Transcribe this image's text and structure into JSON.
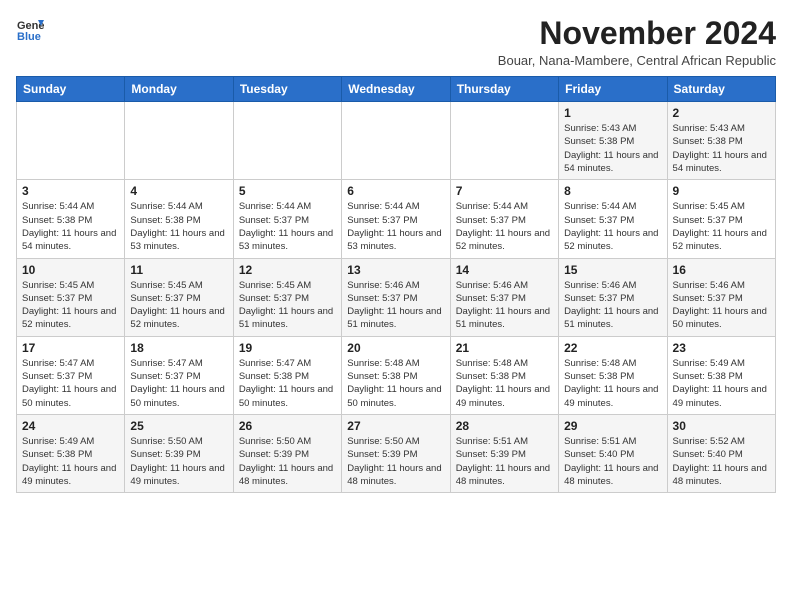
{
  "header": {
    "logo_general": "General",
    "logo_blue": "Blue",
    "title": "November 2024",
    "subtitle": "Bouar, Nana-Mambere, Central African Republic"
  },
  "weekdays": [
    "Sunday",
    "Monday",
    "Tuesday",
    "Wednesday",
    "Thursday",
    "Friday",
    "Saturday"
  ],
  "weeks": [
    [
      {
        "day": "",
        "info": ""
      },
      {
        "day": "",
        "info": ""
      },
      {
        "day": "",
        "info": ""
      },
      {
        "day": "",
        "info": ""
      },
      {
        "day": "",
        "info": ""
      },
      {
        "day": "1",
        "info": "Sunrise: 5:43 AM\nSunset: 5:38 PM\nDaylight: 11 hours and 54 minutes."
      },
      {
        "day": "2",
        "info": "Sunrise: 5:43 AM\nSunset: 5:38 PM\nDaylight: 11 hours and 54 minutes."
      }
    ],
    [
      {
        "day": "3",
        "info": "Sunrise: 5:44 AM\nSunset: 5:38 PM\nDaylight: 11 hours and 54 minutes."
      },
      {
        "day": "4",
        "info": "Sunrise: 5:44 AM\nSunset: 5:38 PM\nDaylight: 11 hours and 53 minutes."
      },
      {
        "day": "5",
        "info": "Sunrise: 5:44 AM\nSunset: 5:37 PM\nDaylight: 11 hours and 53 minutes."
      },
      {
        "day": "6",
        "info": "Sunrise: 5:44 AM\nSunset: 5:37 PM\nDaylight: 11 hours and 53 minutes."
      },
      {
        "day": "7",
        "info": "Sunrise: 5:44 AM\nSunset: 5:37 PM\nDaylight: 11 hours and 52 minutes."
      },
      {
        "day": "8",
        "info": "Sunrise: 5:44 AM\nSunset: 5:37 PM\nDaylight: 11 hours and 52 minutes."
      },
      {
        "day": "9",
        "info": "Sunrise: 5:45 AM\nSunset: 5:37 PM\nDaylight: 11 hours and 52 minutes."
      }
    ],
    [
      {
        "day": "10",
        "info": "Sunrise: 5:45 AM\nSunset: 5:37 PM\nDaylight: 11 hours and 52 minutes."
      },
      {
        "day": "11",
        "info": "Sunrise: 5:45 AM\nSunset: 5:37 PM\nDaylight: 11 hours and 52 minutes."
      },
      {
        "day": "12",
        "info": "Sunrise: 5:45 AM\nSunset: 5:37 PM\nDaylight: 11 hours and 51 minutes."
      },
      {
        "day": "13",
        "info": "Sunrise: 5:46 AM\nSunset: 5:37 PM\nDaylight: 11 hours and 51 minutes."
      },
      {
        "day": "14",
        "info": "Sunrise: 5:46 AM\nSunset: 5:37 PM\nDaylight: 11 hours and 51 minutes."
      },
      {
        "day": "15",
        "info": "Sunrise: 5:46 AM\nSunset: 5:37 PM\nDaylight: 11 hours and 51 minutes."
      },
      {
        "day": "16",
        "info": "Sunrise: 5:46 AM\nSunset: 5:37 PM\nDaylight: 11 hours and 50 minutes."
      }
    ],
    [
      {
        "day": "17",
        "info": "Sunrise: 5:47 AM\nSunset: 5:37 PM\nDaylight: 11 hours and 50 minutes."
      },
      {
        "day": "18",
        "info": "Sunrise: 5:47 AM\nSunset: 5:37 PM\nDaylight: 11 hours and 50 minutes."
      },
      {
        "day": "19",
        "info": "Sunrise: 5:47 AM\nSunset: 5:38 PM\nDaylight: 11 hours and 50 minutes."
      },
      {
        "day": "20",
        "info": "Sunrise: 5:48 AM\nSunset: 5:38 PM\nDaylight: 11 hours and 50 minutes."
      },
      {
        "day": "21",
        "info": "Sunrise: 5:48 AM\nSunset: 5:38 PM\nDaylight: 11 hours and 49 minutes."
      },
      {
        "day": "22",
        "info": "Sunrise: 5:48 AM\nSunset: 5:38 PM\nDaylight: 11 hours and 49 minutes."
      },
      {
        "day": "23",
        "info": "Sunrise: 5:49 AM\nSunset: 5:38 PM\nDaylight: 11 hours and 49 minutes."
      }
    ],
    [
      {
        "day": "24",
        "info": "Sunrise: 5:49 AM\nSunset: 5:38 PM\nDaylight: 11 hours and 49 minutes."
      },
      {
        "day": "25",
        "info": "Sunrise: 5:50 AM\nSunset: 5:39 PM\nDaylight: 11 hours and 49 minutes."
      },
      {
        "day": "26",
        "info": "Sunrise: 5:50 AM\nSunset: 5:39 PM\nDaylight: 11 hours and 48 minutes."
      },
      {
        "day": "27",
        "info": "Sunrise: 5:50 AM\nSunset: 5:39 PM\nDaylight: 11 hours and 48 minutes."
      },
      {
        "day": "28",
        "info": "Sunrise: 5:51 AM\nSunset: 5:39 PM\nDaylight: 11 hours and 48 minutes."
      },
      {
        "day": "29",
        "info": "Sunrise: 5:51 AM\nSunset: 5:40 PM\nDaylight: 11 hours and 48 minutes."
      },
      {
        "day": "30",
        "info": "Sunrise: 5:52 AM\nSunset: 5:40 PM\nDaylight: 11 hours and 48 minutes."
      }
    ]
  ]
}
